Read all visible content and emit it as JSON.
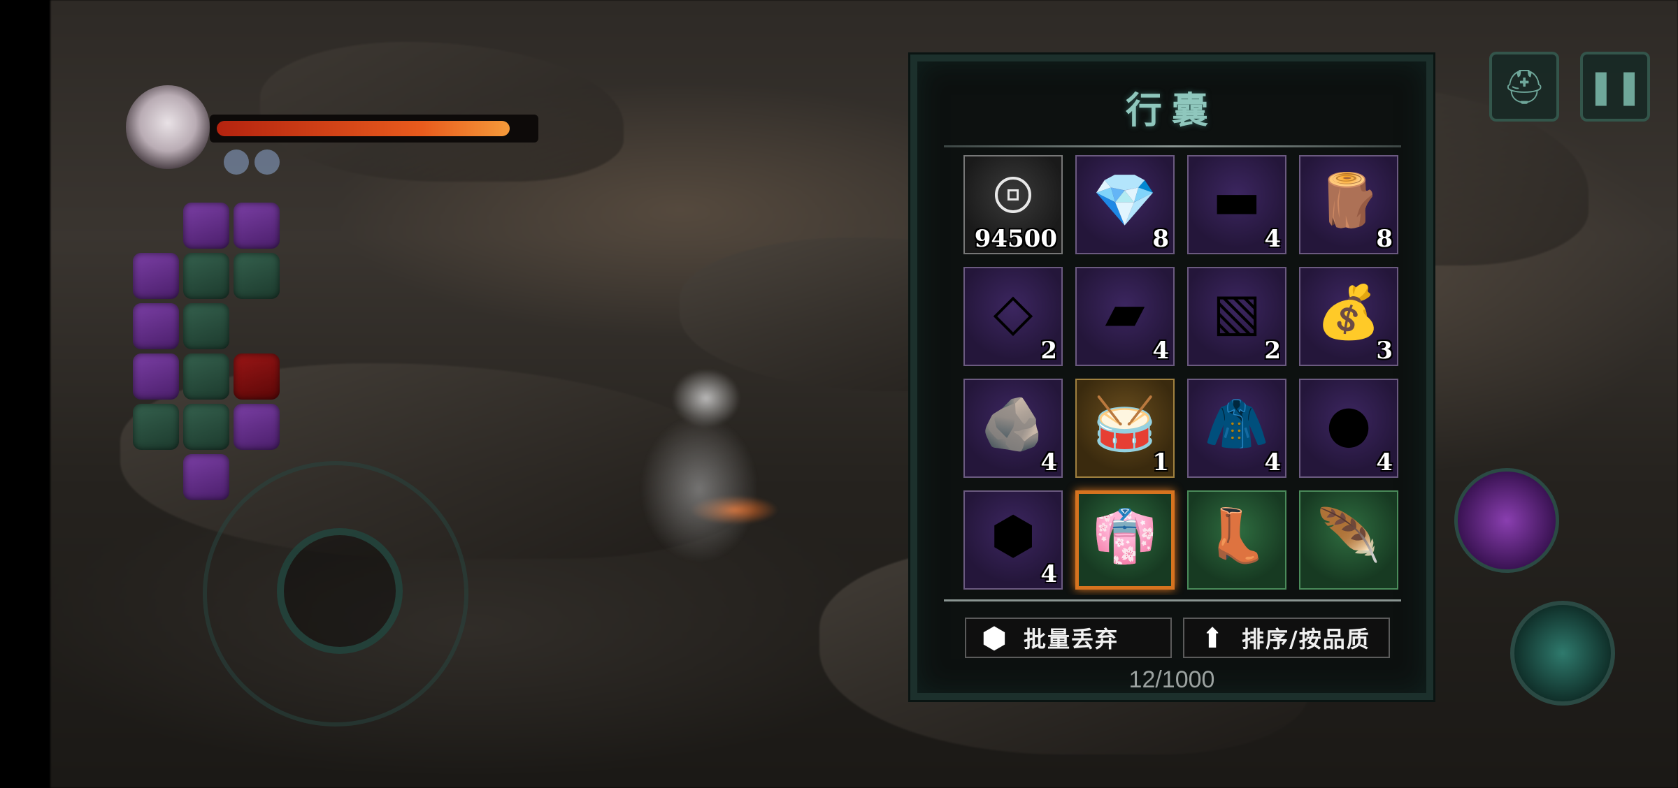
{
  "hud": {
    "hp_fraction": 0.93,
    "mp_dots": 2,
    "menu_icon": "helmet-icon",
    "pause_icon": "pause-icon"
  },
  "inventory": {
    "title": "行囊",
    "slots": [
      {
        "icon": "coin-icon",
        "count": "94500",
        "rarity": "gray"
      },
      {
        "icon": "pink-crystal-icon",
        "glyph": "💎",
        "count": "8",
        "rarity": "purple"
      },
      {
        "icon": "silver-ingot-icon",
        "glyph": "▬",
        "count": "4",
        "rarity": "purple"
      },
      {
        "icon": "wood-log-icon",
        "glyph": "🪵",
        "count": "8",
        "rarity": "purple"
      },
      {
        "icon": "steel-plate-icon",
        "glyph": "◇",
        "count": "2",
        "rarity": "purple"
      },
      {
        "icon": "gold-ingot-icon",
        "glyph": "▰",
        "count": "4",
        "rarity": "purple"
      },
      {
        "icon": "cyan-cloth-icon",
        "glyph": "▧",
        "count": "2",
        "rarity": "purple"
      },
      {
        "icon": "blue-pouch-icon",
        "glyph": "💰",
        "count": "3",
        "rarity": "purple"
      },
      {
        "icon": "silver-ore-icon",
        "glyph": "🪨",
        "count": "4",
        "rarity": "purple"
      },
      {
        "icon": "drum-icon",
        "glyph": "🥁",
        "count": "1",
        "rarity": "gold"
      },
      {
        "icon": "dark-robe-icon",
        "glyph": "🧥",
        "count": "4",
        "rarity": "purple"
      },
      {
        "icon": "black-ore-icon",
        "glyph": "●",
        "count": "4",
        "rarity": "purple"
      },
      {
        "icon": "gold-ore-icon",
        "glyph": "⬢",
        "count": "4",
        "rarity": "purple"
      },
      {
        "icon": "red-armor-icon",
        "glyph": "👘",
        "count": "",
        "rarity": "green",
        "selected": true
      },
      {
        "icon": "boots-icon",
        "glyph": "👢",
        "count": "",
        "rarity": "green"
      },
      {
        "icon": "feather-ornament-icon",
        "glyph": "🪶",
        "count": "",
        "rarity": "green"
      },
      {
        "icon": "partial-slot",
        "glyph": "",
        "count": "",
        "rarity": "green"
      },
      {
        "icon": "partial-slot",
        "glyph": "",
        "count": "",
        "rarity": "green"
      },
      {
        "icon": "partial-slot",
        "glyph": "",
        "count": "",
        "rarity": "gold"
      },
      {
        "icon": "partial-slot",
        "glyph": "",
        "count": "",
        "rarity": "gold"
      }
    ],
    "discard_label": "批量丢弃",
    "sort_label": "排序/按品质",
    "capacity": "12/1000"
  }
}
